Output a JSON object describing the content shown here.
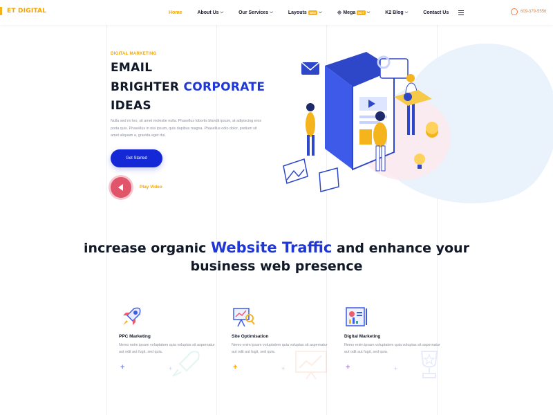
{
  "header": {
    "logo_text": "ET DIGITAL",
    "nav": [
      {
        "label": "Home",
        "active": true
      },
      {
        "label": "About Us",
        "dropdown": true
      },
      {
        "label": "Our Services",
        "dropdown": true
      },
      {
        "label": "Layouts",
        "badge": "NEW",
        "dropdown": true
      },
      {
        "label": "Mega",
        "badge": "HOT",
        "icon": "mega-menu-icon",
        "dropdown": true
      },
      {
        "label": "K2 Blog",
        "dropdown": true
      },
      {
        "label": "Contact Us"
      }
    ],
    "menu_icon": "hamburger-icon",
    "phone": "609-379-5556",
    "phone_icon": "phone-icon"
  },
  "hero": {
    "eyebrow": "DIGITAL MARKETING",
    "line1": "EMAIL",
    "line2_plain": "BRIGHTER ",
    "line2_accent": "CORPORATE",
    "line3": "IDEAS",
    "body": "Nulla sed mi leo, sit amet molestie nulla. Phasellus lobortis blandit ipsum, at adipiscing eros porta quis. Phasellus in nisi ipsum, quis dapibus magna. Phasellus odio dolor, pretium sit amet aliquam a, gravida eget dui.",
    "cta_label": "Get Started",
    "play_label": "Play Video",
    "illustration": "isometric-digital-marketing-illustration"
  },
  "section": {
    "heading_plain1": "increase organic ",
    "heading_accent": "Website Traffic",
    "heading_plain2": " and enhance your",
    "heading_line2": "business web presence"
  },
  "services": [
    {
      "title": "PPC Marketing",
      "text": "Nemo enim ipsam voluptatem quia voluptas sit aspernatur aut odit aut fugit, sed quia.",
      "icon": "rocket-icon",
      "plus_color": "#7f8ff4"
    },
    {
      "title": "Site Optimisation",
      "text": "Nemo enim ipsam voluptatem quia voluptas sit aspernatur aut odit aut fugit, sed quia.",
      "icon": "presentation-chart-icon",
      "plus_color": "#f5a400"
    },
    {
      "title": "Digital Marketing",
      "text": "Nemo enim ipsam voluptatem quia voluptas sit aspernatur aut odit aut fugit, sed quia.",
      "icon": "report-icon",
      "plus_color": "#b08bf0"
    }
  ],
  "colors": {
    "accent_blue": "#1f37d6",
    "accent_yellow": "#f5a400",
    "play_red": "#e0556a",
    "phone_orange": "#f47a3c"
  }
}
